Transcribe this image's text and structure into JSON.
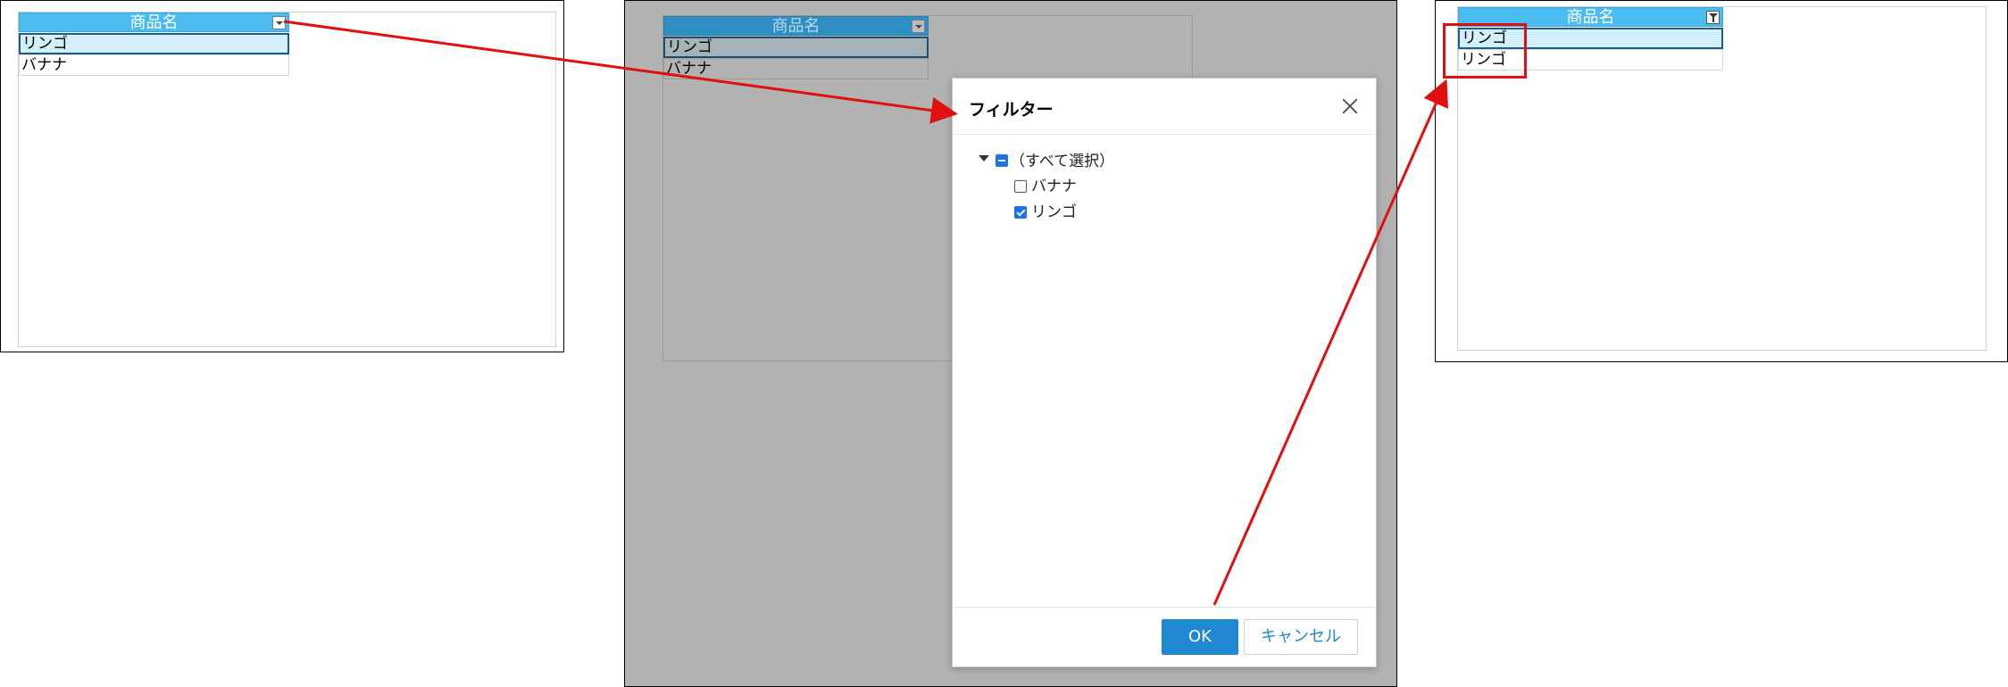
{
  "panel_before": {
    "column_header": "商品名",
    "rows": [
      "リンゴ",
      "バナナ"
    ]
  },
  "panel_dialog": {
    "column_header": "商品名",
    "rows": [
      "リンゴ",
      "バナナ"
    ],
    "dialog": {
      "title": "フィルター",
      "select_all_label": "（すべて選択）",
      "items": [
        {
          "label": "バナナ",
          "checked": false
        },
        {
          "label": "リンゴ",
          "checked": true
        }
      ],
      "ok_label": "OK",
      "cancel_label": "キャンセル"
    }
  },
  "panel_after": {
    "column_header": "商品名",
    "rows": [
      "リンゴ",
      "リンゴ"
    ]
  },
  "colors": {
    "header": "#4bbcf0",
    "selected_row": "#d3effb",
    "overlay": "#b2b2b2",
    "primary_button": "#1f88d1",
    "annotation": "#e01010"
  },
  "icons": [
    "dropdown-arrow-icon",
    "close-icon",
    "tree-collapse-icon",
    "checkbox-indeterminate-icon",
    "checkbox-icon",
    "filter-icon"
  ]
}
